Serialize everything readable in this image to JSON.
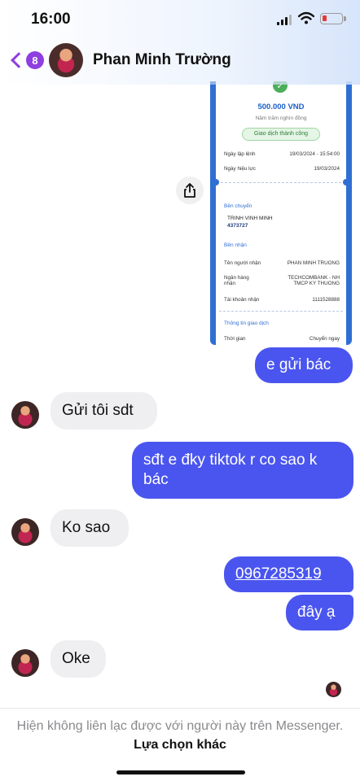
{
  "status_bar": {
    "time": "16:00"
  },
  "header": {
    "unread_count": "8",
    "contact_name": "Phan Minh Trường"
  },
  "receipt": {
    "amount": "500.000 VND",
    "amount_words": "Năm trăm nghìn đồng",
    "status": "Giao dịch thành công",
    "created_label": "Ngày lập lệnh",
    "created_value": "19/03/2024 - 15:54:00",
    "effective_label": "Ngày hiệu lực",
    "effective_value": "19/03/2024",
    "sender_section": "Bên chuyển",
    "sender_name": "TRINH VINH MINH",
    "sender_account": "4373727",
    "receiver_section": "Bên nhận",
    "receiver_name_label": "Tên người nhận",
    "receiver_name_value": "PHAN MINH TRUONG",
    "bank_label": "Ngân hàng nhận",
    "bank_value": "TECHCOMBANK - NH TMCP KY THUONG",
    "account_label": "Tài khoản nhận",
    "account_value": "1111528888",
    "info_section": "Thông tin giao dịch",
    "time_label": "Thời gian",
    "time_value": "Chuyển ngay"
  },
  "messages": [
    {
      "sender": "me",
      "text": "e gửi bác"
    },
    {
      "sender": "contact",
      "text": "Gửi tôi sdt"
    },
    {
      "sender": "me",
      "text": "sđt e đky tiktok r co sao k bác"
    },
    {
      "sender": "contact",
      "text": "Ko sao"
    },
    {
      "sender": "me",
      "text": "0967285319"
    },
    {
      "sender": "me",
      "text": "đây ạ"
    },
    {
      "sender": "contact",
      "text": "Oke"
    }
  ],
  "footer": {
    "notice": "Hiện không liên lạc được với người này trên Messenger.",
    "link": "Lựa chọn khác"
  },
  "colors": {
    "outgoing_bubble": "#4a55ef",
    "incoming_bubble": "#efeff1",
    "accent": "#8e3fe0"
  }
}
